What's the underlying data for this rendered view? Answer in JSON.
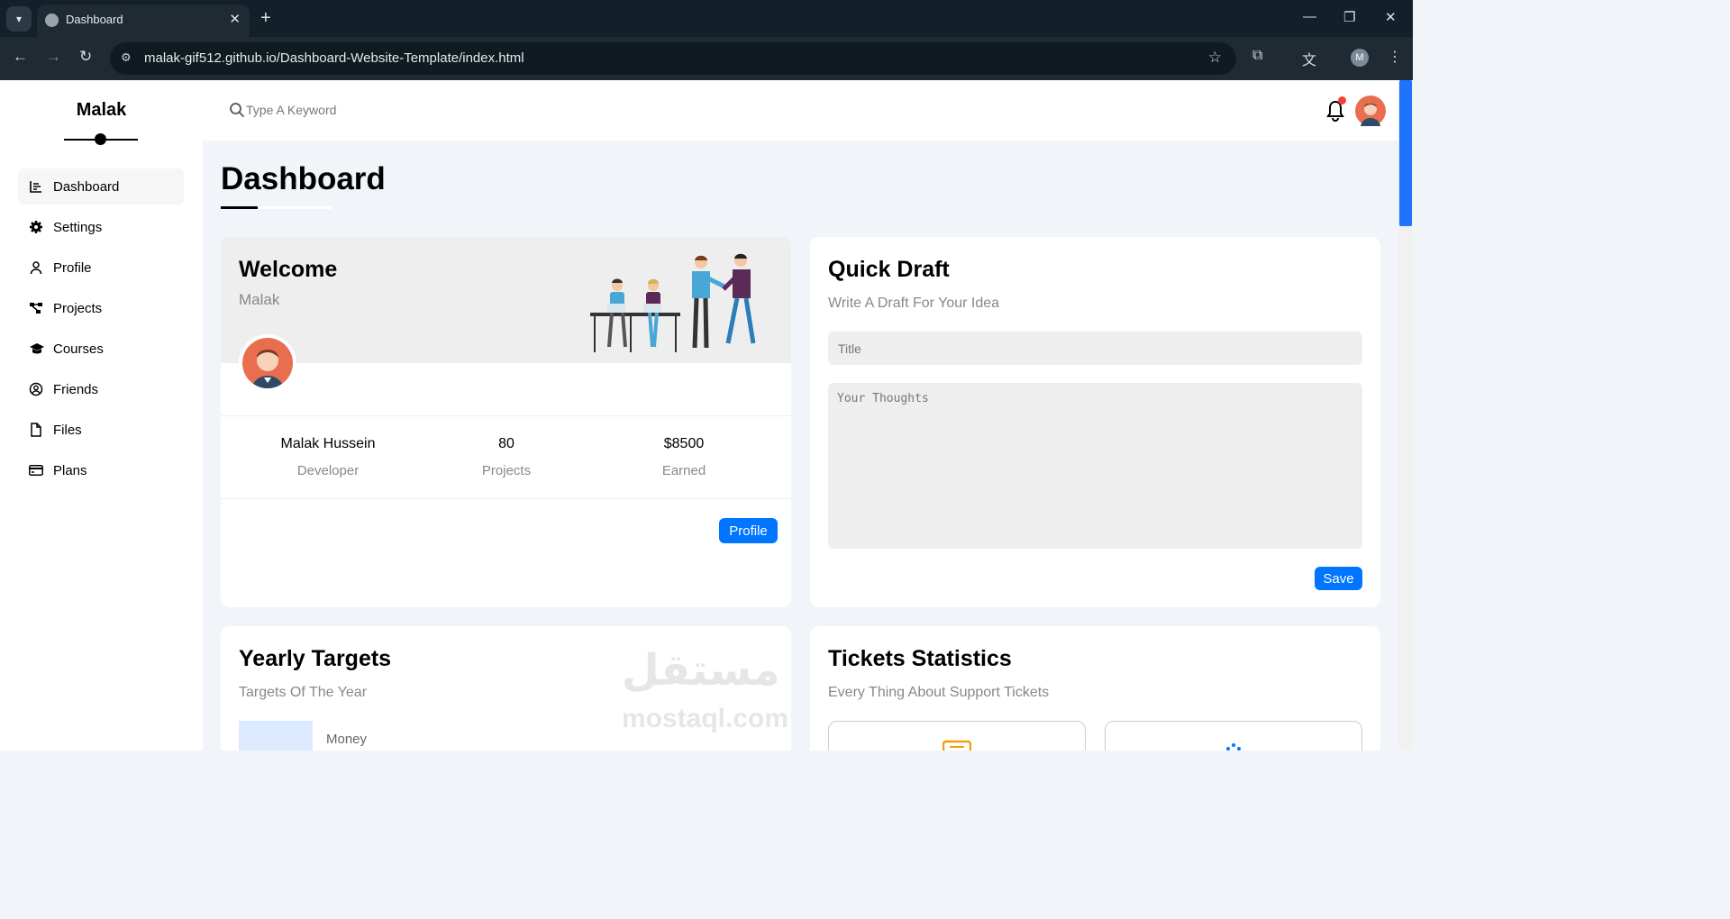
{
  "browser": {
    "tab_title": "Dashboard",
    "url": "malak-gif512.github.io/Dashboard-Website-Template/index.html",
    "profile_initial": "M"
  },
  "brand": "Malak",
  "sidebar": {
    "items": [
      {
        "label": "Dashboard",
        "icon": "chart-bars-icon",
        "active": true
      },
      {
        "label": "Settings",
        "icon": "gear-icon"
      },
      {
        "label": "Profile",
        "icon": "user-icon"
      },
      {
        "label": "Projects",
        "icon": "diagram-icon"
      },
      {
        "label": "Courses",
        "icon": "graduation-cap-icon"
      },
      {
        "label": "Friends",
        "icon": "user-circle-icon"
      },
      {
        "label": "Files",
        "icon": "file-icon"
      },
      {
        "label": "Plans",
        "icon": "credit-card-icon"
      }
    ]
  },
  "header": {
    "search_placeholder": "Type A Keyword"
  },
  "page_title": "Dashboard",
  "welcome": {
    "title": "Welcome",
    "name": "Malak",
    "stats": [
      {
        "value": "Malak Hussein",
        "label": "Developer"
      },
      {
        "value": "80",
        "label": "Projects"
      },
      {
        "value": "$8500",
        "label": "Earned"
      }
    ],
    "button": "Profile"
  },
  "draft": {
    "title": "Quick Draft",
    "subtitle": "Write A Draft For Your Idea",
    "title_placeholder": "Title",
    "body_placeholder": "Your Thoughts",
    "button": "Save"
  },
  "targets": {
    "title": "Yearly Targets",
    "subtitle": "Targets Of The Year",
    "first_label": "Money"
  },
  "tickets": {
    "title": "Tickets Statistics",
    "subtitle": "Every Thing About Support Tickets"
  },
  "watermark": {
    "arabic": "مستقل",
    "latin": "mostaql.com"
  },
  "colors": {
    "accent": "#0075ff",
    "avatar": "#e96e50",
    "notification": "#f44336"
  }
}
